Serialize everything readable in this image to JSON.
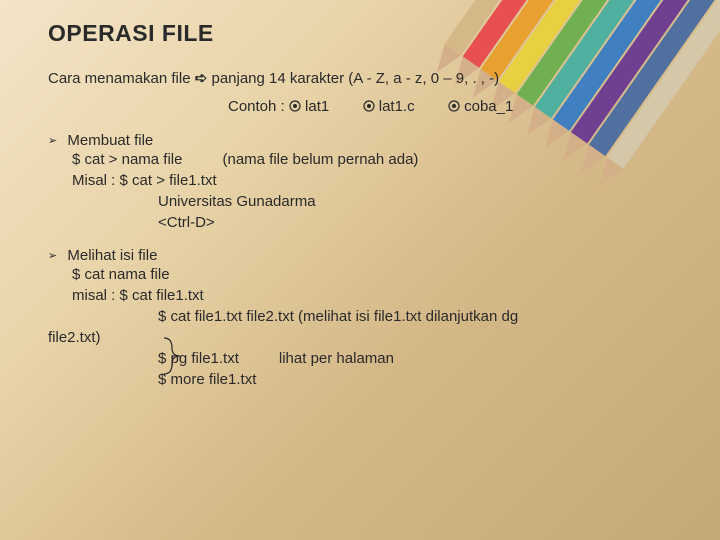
{
  "title": "OPERASI FILE",
  "intro": {
    "line1_pre": "Cara menamakan file ",
    "line1_arrow": "➪",
    "line1_post": " panjang 14 karakter (A - Z, a - z, 0 – 9, . , -)",
    "line2_label": "Contoh : ",
    "examples": [
      "lat1",
      "lat1.c",
      "coba_1"
    ]
  },
  "sections": [
    {
      "heading": "Membuat file",
      "lines": [
        {
          "left": "$ cat > nama file",
          "right": "(nama file belum pernah ada)"
        },
        {
          "left": "Misal :   $ cat > file1.txt"
        },
        {
          "indent": "ind3",
          "left": "Universitas Gunadarma"
        },
        {
          "indent": "ind3",
          "left": "<Ctrl-D>"
        }
      ]
    },
    {
      "heading": "Melihat isi file",
      "lines": [
        {
          "left": "$ cat nama file"
        },
        {
          "left": "misal :   $ cat file1.txt"
        },
        {
          "indent": "ind-note",
          "left": "$ cat file1.txt   file2.txt   (melihat isi file1.txt dilanjutkan dg"
        },
        {
          "indent": "none",
          "left": "file2.txt)"
        },
        {
          "indent": "ind-note",
          "left": "$ pg file1.txt",
          "right": "lihat per halaman"
        },
        {
          "indent": "ind-note",
          "left": "$ more file1.txt"
        }
      ]
    }
  ]
}
